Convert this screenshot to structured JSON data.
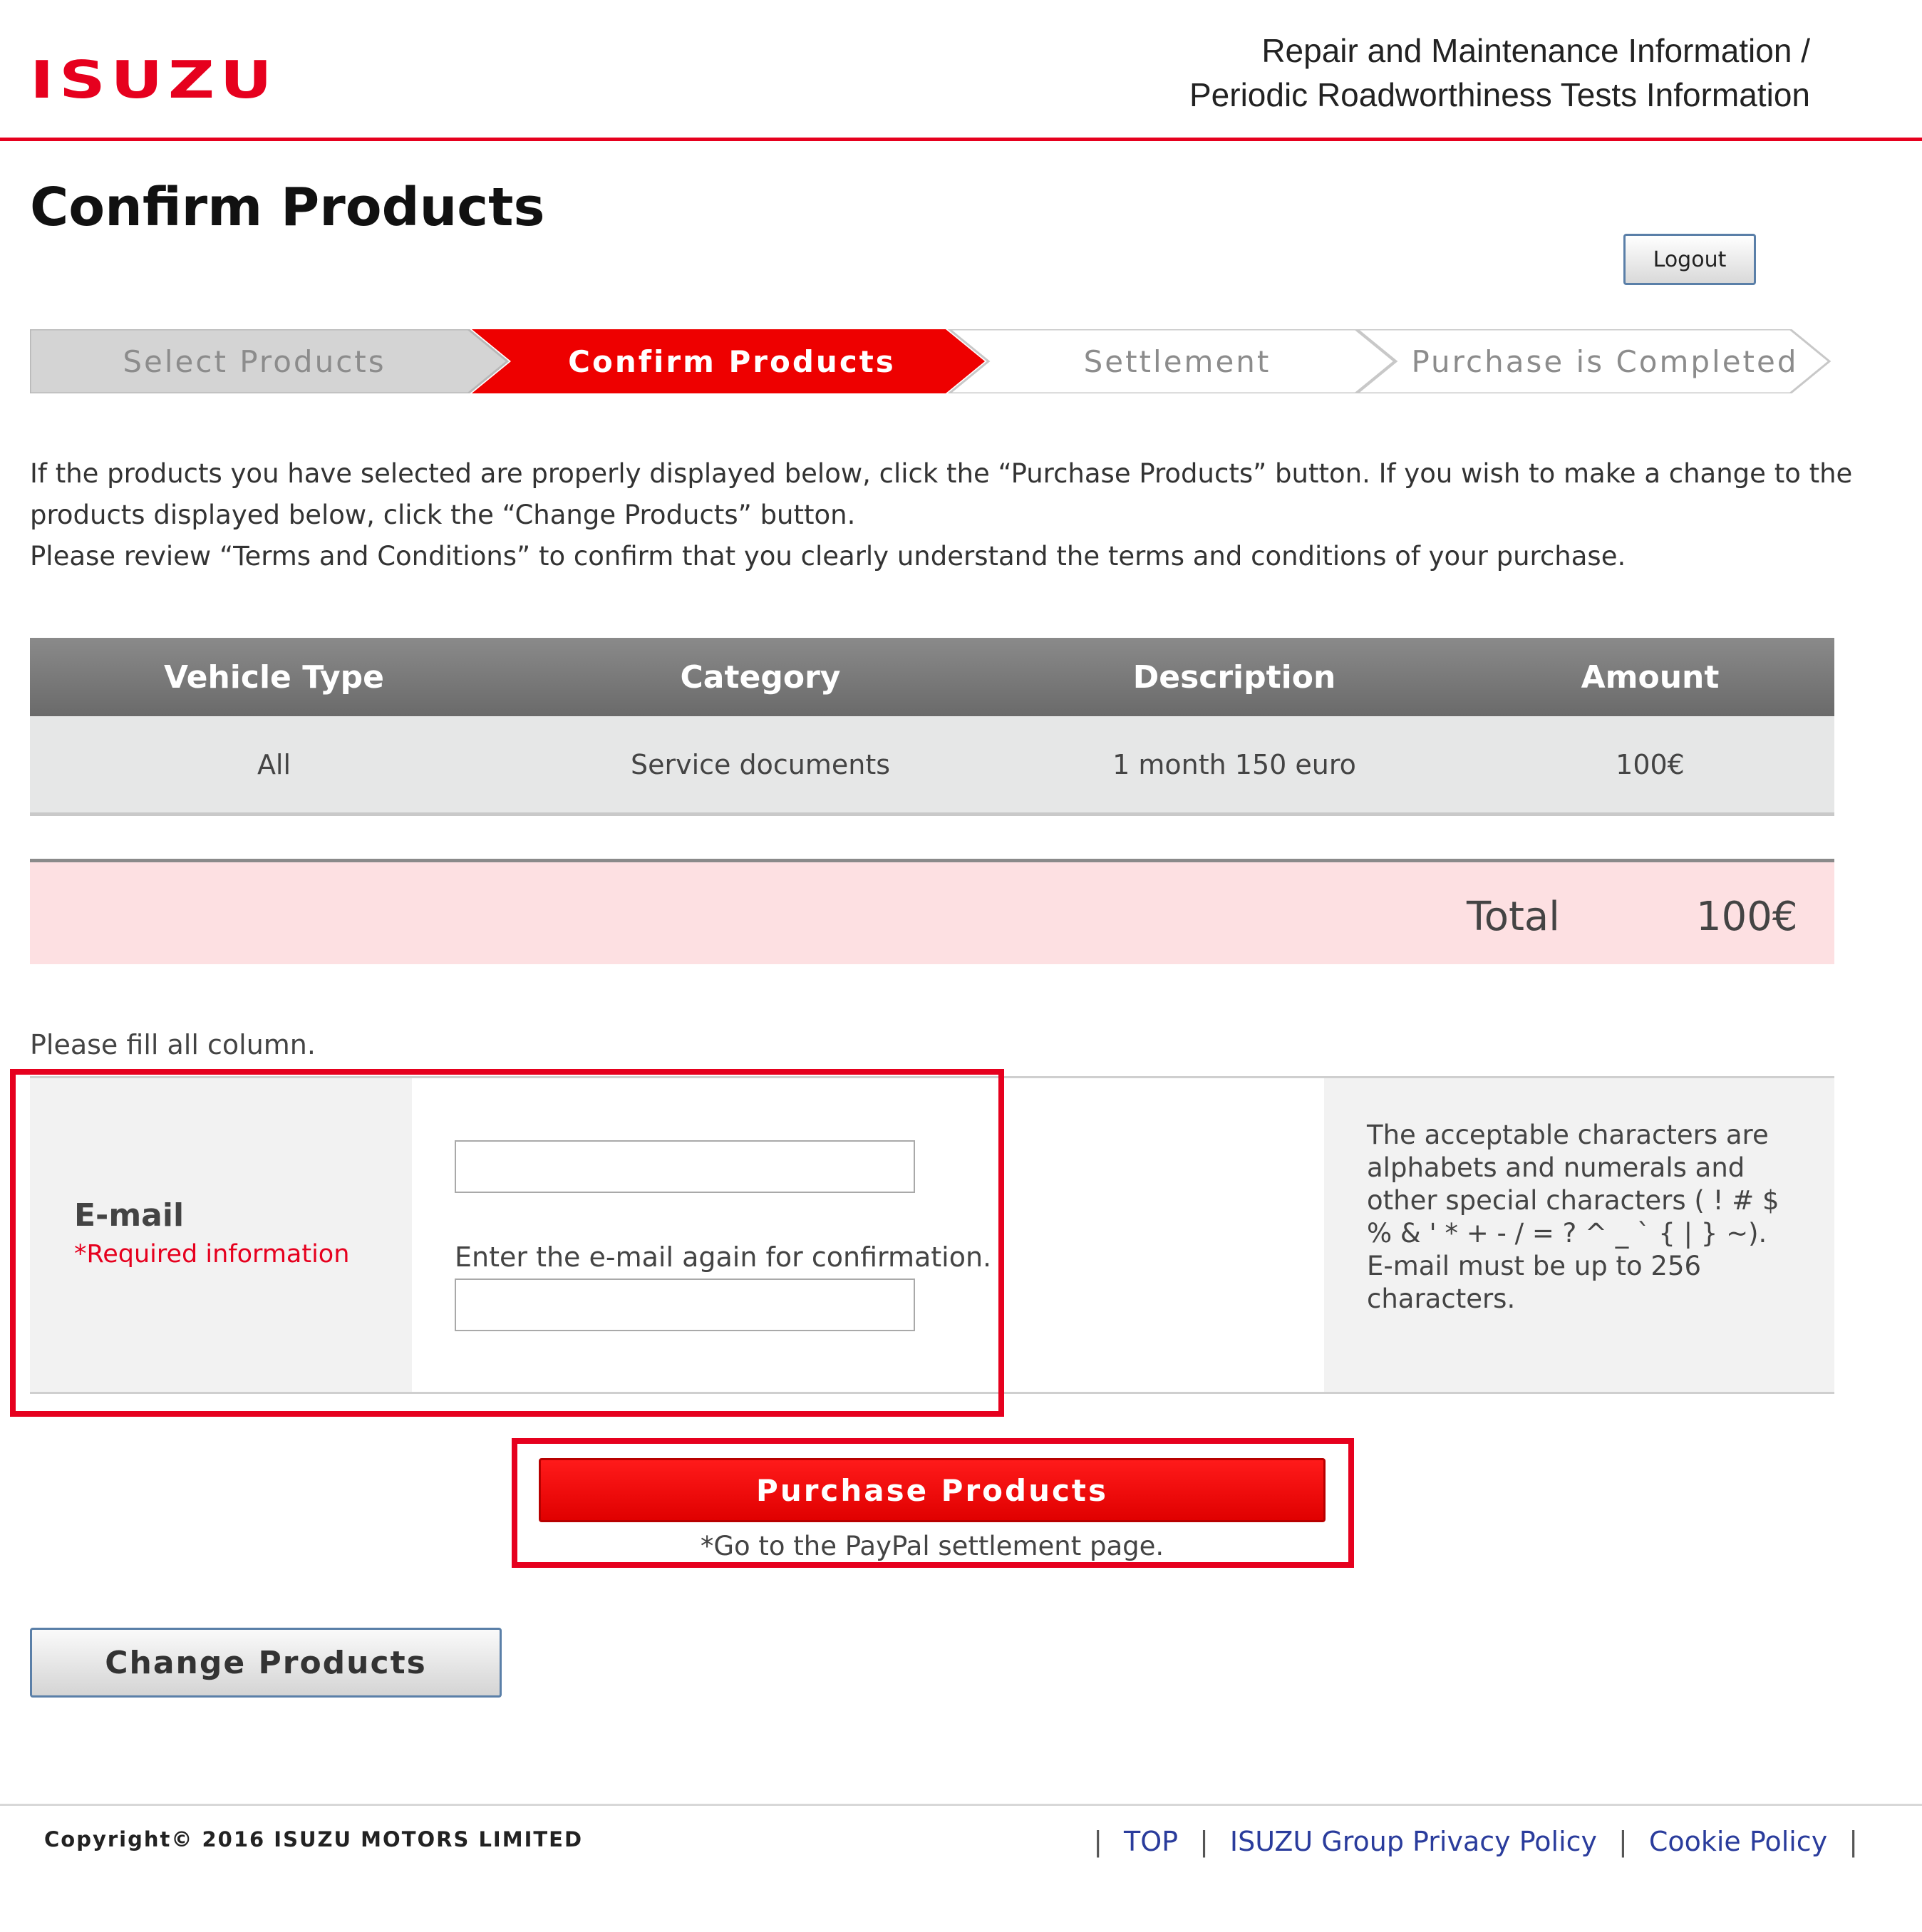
{
  "header": {
    "logo_text": "ISUZU",
    "site_title_line1": "Repair and Maintenance Information /",
    "site_title_line2": "Periodic Roadworthiness Tests Information",
    "accent_color": "#e6001e"
  },
  "page_title": "Confirm Products",
  "logout_label": "Logout",
  "steps": [
    {
      "label": "Select Products",
      "state": "done"
    },
    {
      "label": "Confirm Products",
      "state": "current"
    },
    {
      "label": "Settlement",
      "state": "upcoming"
    },
    {
      "label": "Purchase is Completed",
      "state": "upcoming"
    }
  ],
  "intro": {
    "line1": "If the products you have selected are properly displayed below, click the “Purchase Products” button. If you wish to make a change to the products displayed below, click the “Change Products” button.",
    "line2": "Please review “Terms and Conditions” to confirm that you clearly understand the terms and conditions of your purchase."
  },
  "table": {
    "headers": [
      "Vehicle Type",
      "Category",
      "Description",
      "Amount"
    ],
    "rows": [
      [
        "All",
        "Service documents",
        "1 month 150 euro",
        "100€"
      ]
    ]
  },
  "total": {
    "label": "Total",
    "value": "100€"
  },
  "form": {
    "note": "Please fill all column.",
    "email_label": "E-mail",
    "required_label": "*Required information",
    "email_value": "",
    "confirm_label": "Enter the e-mail again for confirmation.",
    "confirm_value": "",
    "help_text1": "The acceptable characters are alphabets and numerals and other special characters ( ! # $ % & ' * + - / = ? ^ _ ` { | } ~).",
    "help_text2": "E-mail must be up to 256 characters."
  },
  "purchase_button": "Purchase Products",
  "paypal_note": "*Go to the PayPal settlement page.",
  "change_button": "Change Products",
  "footer": {
    "copyright": "Copyright© 2016 ISUZU MOTORS LIMITED",
    "links": [
      "TOP",
      "ISUZU Group Privacy Policy",
      "Cookie Policy"
    ]
  }
}
